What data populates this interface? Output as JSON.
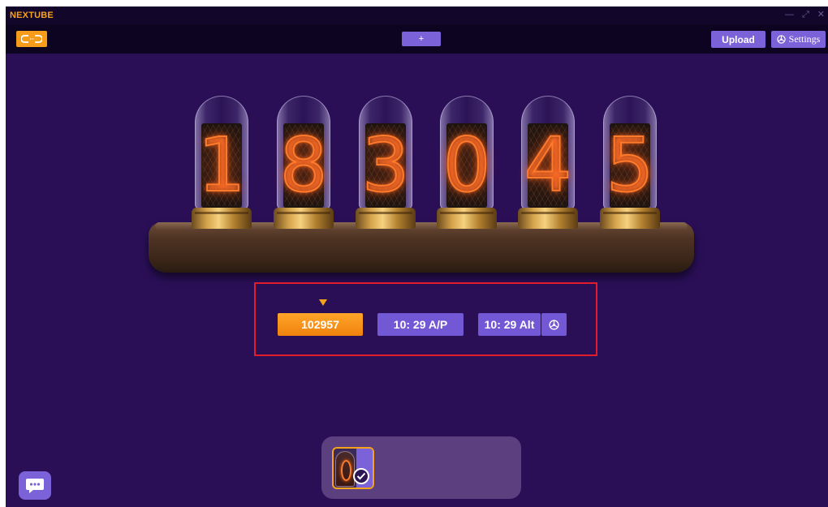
{
  "window": {
    "title": "NEXTUBE",
    "controls": [
      "—",
      "⤢",
      "✕"
    ]
  },
  "toolbar": {
    "link_icon": "link-icon",
    "add_label": "+",
    "upload_label": "Upload",
    "settings_label": "Settings",
    "settings_icon": "steering-wheel-icon"
  },
  "display": {
    "digits": [
      "1",
      "8",
      "3",
      "0",
      "4",
      "5"
    ]
  },
  "modes": {
    "countdown_label": "102957",
    "time_ap_label": "10: 29 A/P",
    "time_alt_label": "10: 29 Alt",
    "selected": "countdown"
  },
  "bottom": {
    "chat_icon": "chat-bubble-icon",
    "theme_selected": true
  },
  "colors": {
    "accent_orange": "#f7a21b",
    "button_purple": "#7b62d8",
    "background": "#2a0f57",
    "highlight_red": "#e21c2c"
  }
}
